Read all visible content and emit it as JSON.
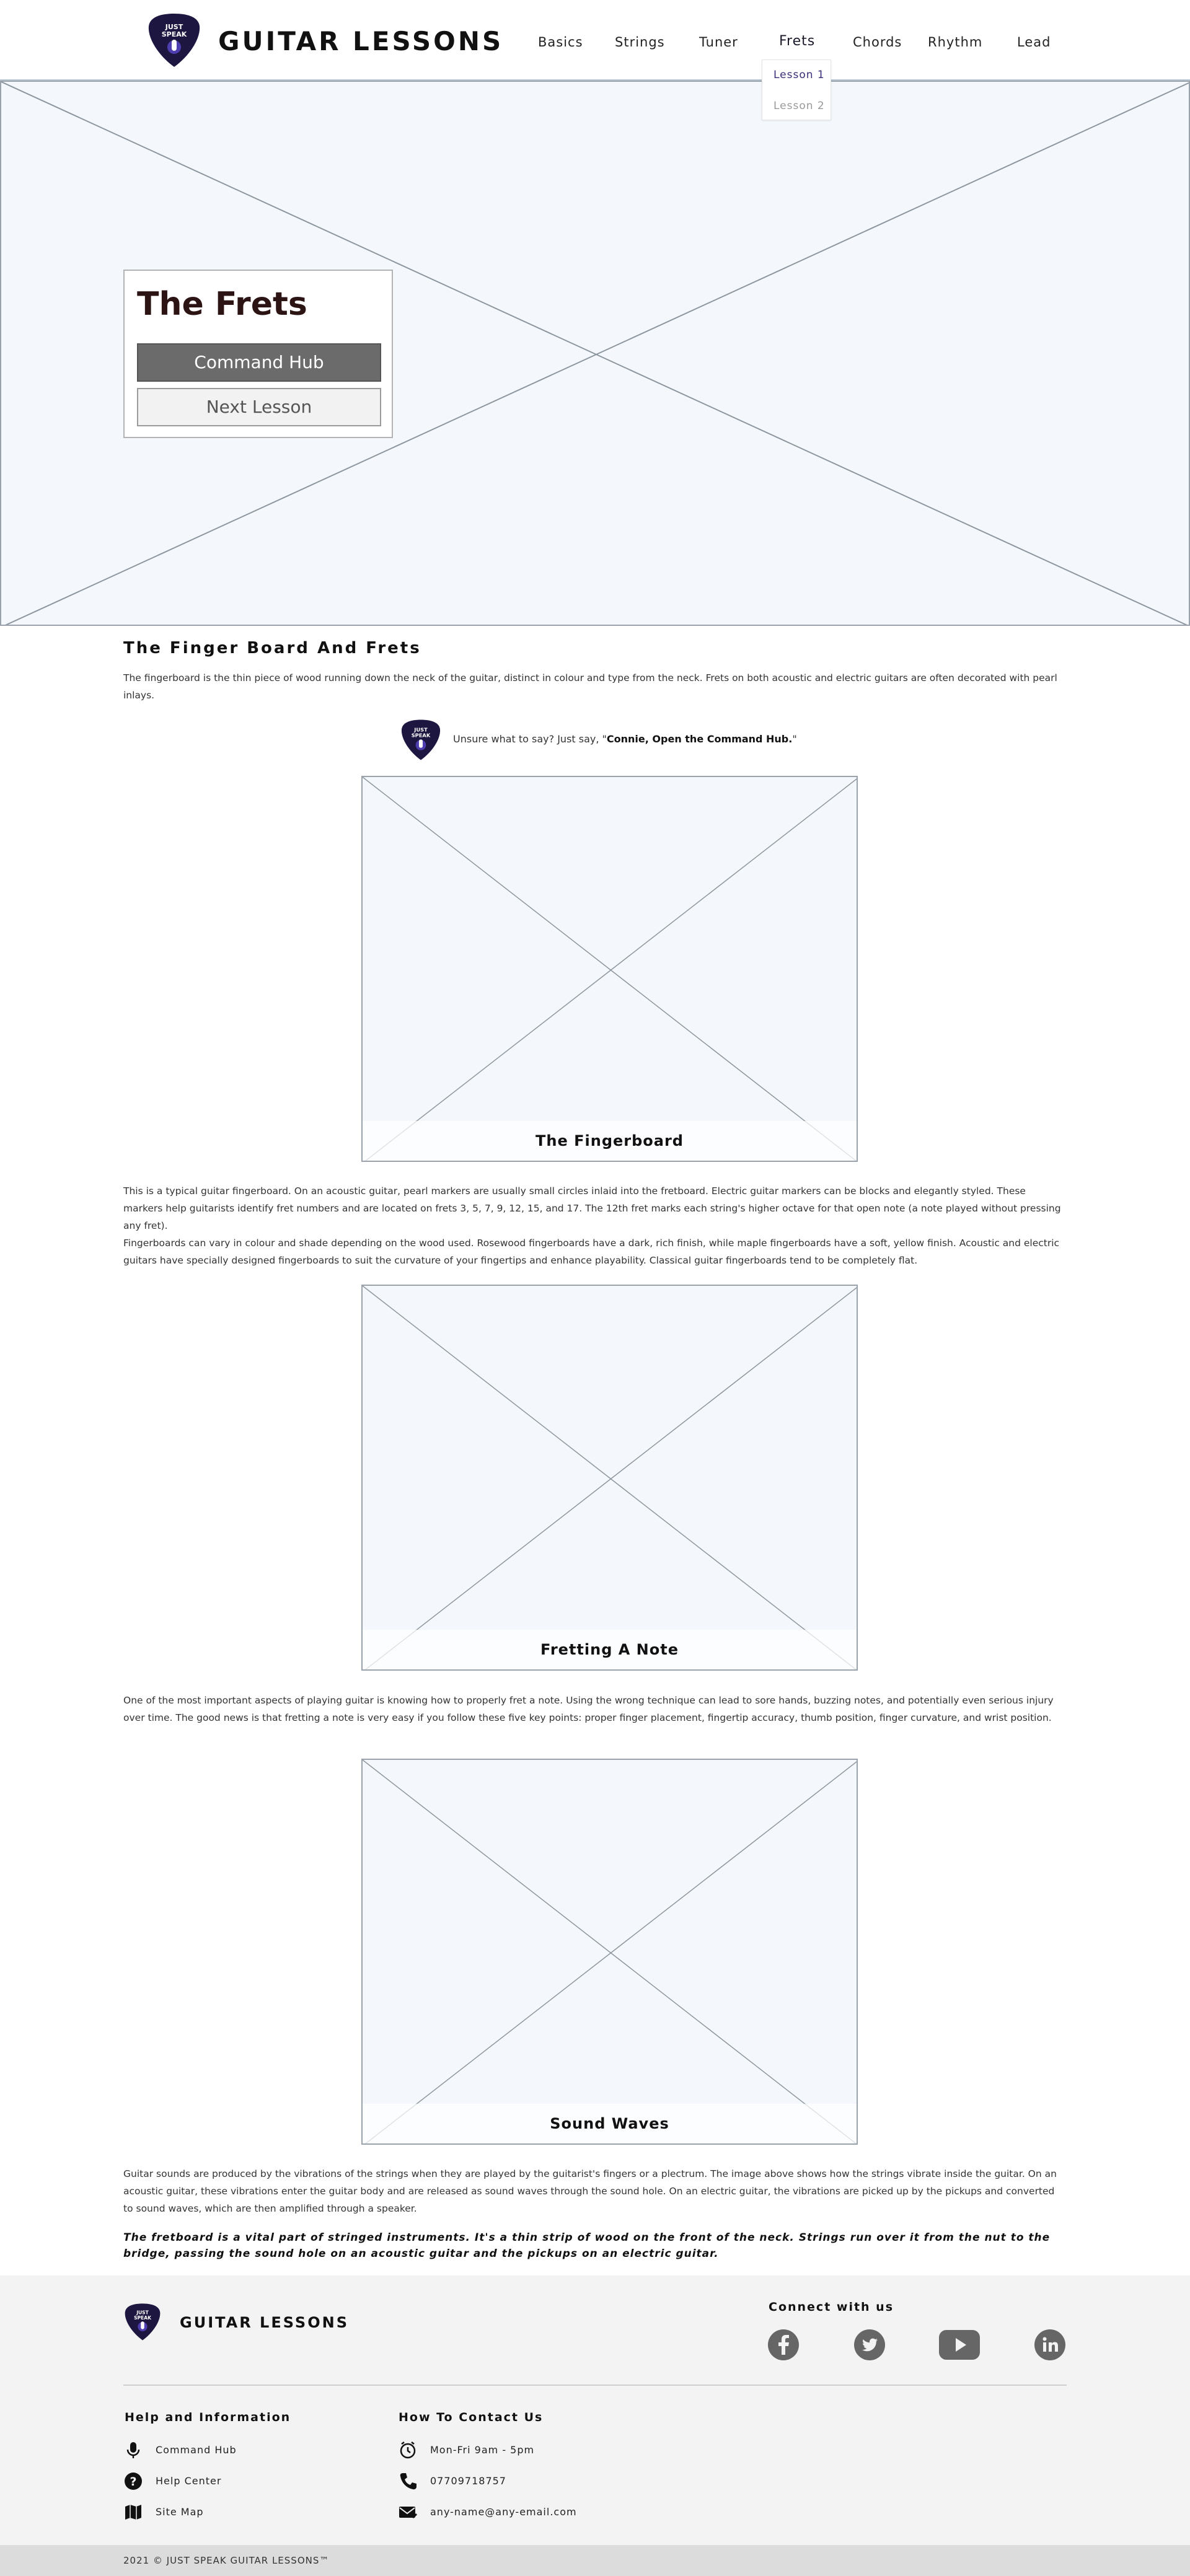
{
  "header": {
    "brand": "GUITAR LESSONS",
    "logo_text_line1": "JUST",
    "logo_text_line2": "SPEAK",
    "nav": [
      "Basics",
      "Strings",
      "Tuner",
      "Frets",
      "Chords",
      "Rhythm",
      "Lead"
    ],
    "active_nav": "Frets",
    "dropdown": [
      "Lesson 1",
      "Lesson 2"
    ]
  },
  "hero": {
    "title": "The Frets",
    "primary_button": "Command Hub",
    "secondary_button": "Next Lesson"
  },
  "section": {
    "heading": "The Finger Board And Frets",
    "intro": "The fingerboard is the thin piece of wood running down the neck of the guitar, distinct in colour and type from the neck. Frets on both acoustic and electric guitars are often decorated with pearl inlays.",
    "tip_prefix": "Unsure what to say? Just say, \"",
    "tip_command": "Connie, Open the Command Hub.",
    "tip_suffix": "\""
  },
  "figures": [
    {
      "caption": "The Fingerboard"
    },
    {
      "caption": "Fretting A Note"
    },
    {
      "caption": "Sound Waves"
    }
  ],
  "paragraphs": {
    "fingerboard_1": "This is a typical guitar fingerboard. On an acoustic guitar, pearl markers are usually small circles inlaid into the fretboard. Electric guitar markers can be blocks and elegantly styled. These markers help guitarists identify fret numbers and are located on frets 3, 5, 7, 9, 12, 15, and 17. The 12th fret marks each string's higher octave for that open note (a note played without pressing any fret).",
    "fingerboard_2": "Fingerboards can vary in colour and shade depending on the wood used. Rosewood fingerboards have a dark, rich finish, while maple fingerboards have a soft, yellow finish. Acoustic and electric guitars have specially designed fingerboards to suit the curvature of your fingertips and enhance playability. Classical guitar fingerboards tend to be completely flat.",
    "fretting": "One of the most important aspects of playing guitar is knowing how to properly fret a note. Using the wrong technique can lead to sore hands, buzzing notes, and potentially even serious injury over time. The good news is that fretting a note is very easy if you follow these five key points: proper finger placement, fingertip accuracy, thumb position, finger curvature, and wrist position.",
    "sound": "Guitar sounds are produced by the vibrations of the strings when they are played by the guitarist's fingers or a plectrum. The image above shows how the strings vibrate inside the guitar. On an acoustic guitar, these vibrations enter the guitar body and are released as sound waves through the sound hole. On an electric guitar, the vibrations are picked up by the pickups and converted to sound waves, which are then amplified through a speaker.",
    "quote": "The fretboard is a vital part of stringed instruments. It's a thin strip of wood on the front of the neck. Strings run over it from the nut to the bridge, passing the sound hole on an acoustic guitar and the pickups on an electric guitar."
  },
  "footer": {
    "brand": "GUITAR LESSONS",
    "connect_heading": "Connect with us",
    "social": [
      "facebook-icon",
      "twitter-icon",
      "youtube-icon",
      "linkedin-icon"
    ],
    "help_heading": "Help and Information",
    "help_links": [
      "Command Hub",
      "Help Center",
      "Site Map"
    ],
    "contact_heading": "How To Contact Us",
    "contact": [
      "Mon-Fri 9am - 5pm",
      "07709718757",
      "any-name@any-email.com"
    ],
    "copyright": "2021 © JUST SPEAK GUITAR LESSONS™"
  },
  "colors": {
    "brand_dark": "#1d1640",
    "placeholder_bg": "#f4f8fd",
    "footer_bg": "#f3f3f3",
    "button_primary": "#6b6b6b",
    "dropdown_active": "#3a2d78"
  }
}
